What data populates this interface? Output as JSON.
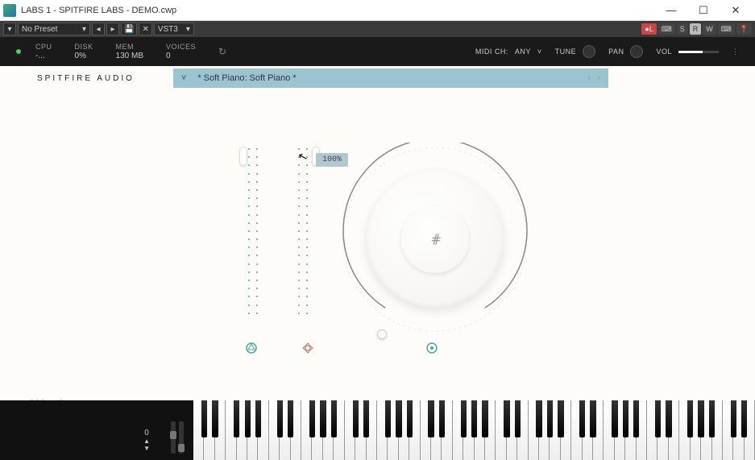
{
  "window": {
    "title": "LABS 1 - SPITFIRE LABS - DEMO.cwp"
  },
  "toolbar": {
    "preset": "No Preset",
    "plugin_format": "VST3",
    "badges": {
      "l": "L",
      "s": "S",
      "r": "R",
      "w": "W"
    }
  },
  "stats": {
    "cpu_label": "CPU",
    "cpu_value": "-...",
    "disk_label": "DISK",
    "disk_value": "0%",
    "mem_label": "MEM",
    "mem_value": "130 MB",
    "voices_label": "VOICES",
    "voices_value": "0",
    "midi_label": "MIDI CH:",
    "midi_value": "ANY",
    "tune_label": "TUNE",
    "pan_label": "PAN",
    "vol_label": "VOL"
  },
  "plugin": {
    "brand": "SPITFIRE AUDIO",
    "patch": "* Soft Piano: Soft Piano *"
  },
  "controls": {
    "slider1_pct": 100,
    "slider2_pct": 100,
    "tooltip": "100%",
    "knob_pct": 0
  },
  "keyboard": {
    "octave": "0",
    "white_keys": 52,
    "mini_slider1": 50,
    "mini_slider2": 10
  },
  "watermark": "filehorse.com",
  "colors": {
    "accent_teal": "#4aa8a8",
    "accent_rose": "#c87878",
    "patch_bg": "#9cc4d0"
  }
}
